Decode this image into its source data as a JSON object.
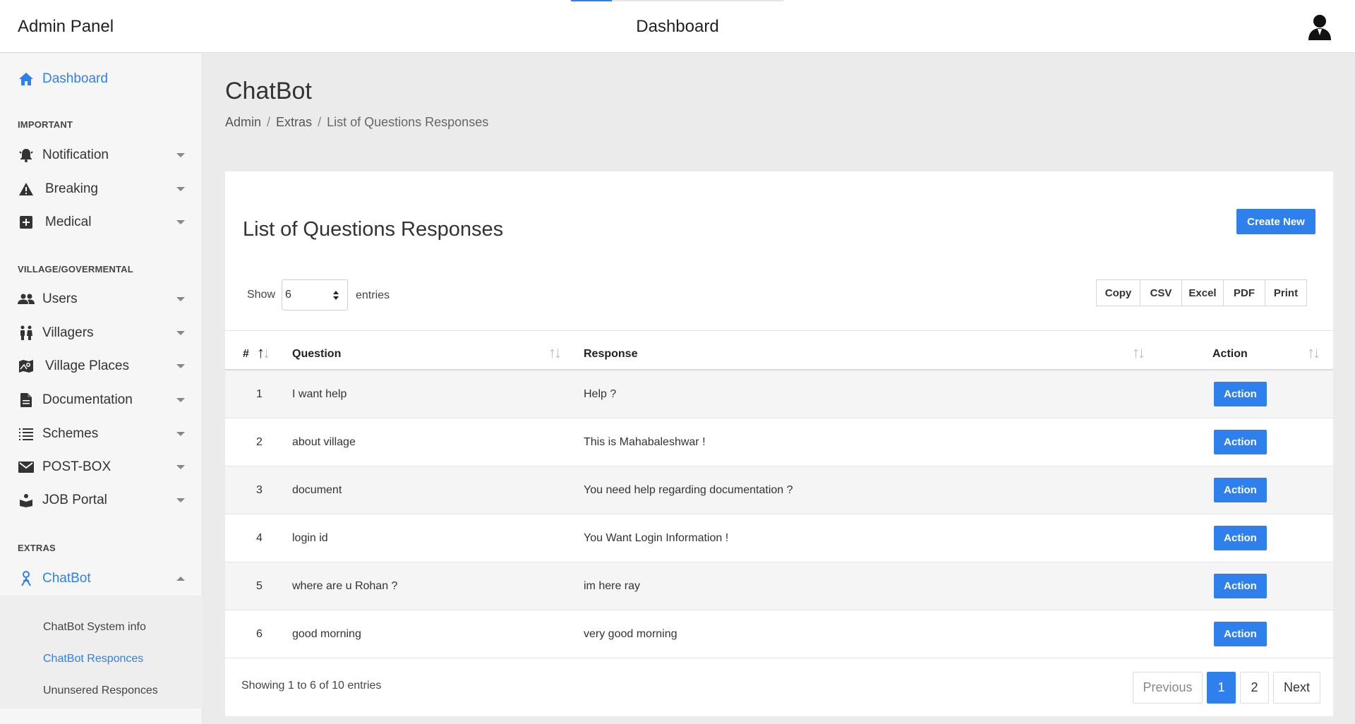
{
  "header": {
    "brand": "Admin Panel",
    "title": "Dashboard",
    "load_progress": 0.193
  },
  "sidebar": {
    "dashboard": "Dashboard",
    "sections": {
      "important": "IMPORTANT",
      "village": "VILLAGE/GOVERMENTAL",
      "extras": "EXTRAS"
    },
    "items": {
      "notification": "Notification",
      "breaking": "Breaking",
      "medical": "Medical",
      "users": "Users",
      "villagers": "Villagers",
      "village_places": "Village Places",
      "documentation": "Documentation",
      "schemes": "Schemes",
      "postbox": "POST-BOX",
      "job_portal": "JOB Portal",
      "chatbot": "ChatBot"
    },
    "chatbot_sub": {
      "system_info": "ChatBot System info",
      "responces": "ChatBot Responces",
      "unanswered": "Ununsered Responces"
    }
  },
  "page": {
    "title": "ChatBot",
    "breadcrumb": [
      "Admin",
      "Extras",
      "List of Questions Responses"
    ]
  },
  "card": {
    "title": "List of Questions Responses",
    "create_label": "Create New",
    "show_label": "Show",
    "page_size": "6",
    "entries_label": "entries",
    "exports": [
      "Copy",
      "CSV",
      "Excel",
      "PDF",
      "Print"
    ],
    "columns": [
      "#",
      "Question",
      "Response",
      "Action"
    ],
    "rows": [
      {
        "num": "1",
        "question": "I want help",
        "response": "Help ?",
        "action": "Action"
      },
      {
        "num": "2",
        "question": "about village",
        "response": "This is Mahabaleshwar !",
        "action": "Action"
      },
      {
        "num": "3",
        "question": "document",
        "response": "You need help regarding documentation ?",
        "action": "Action"
      },
      {
        "num": "4",
        "question": "login id",
        "response": "You Want Login Information !",
        "action": "Action"
      },
      {
        "num": "5",
        "question": "where are u Rohan ?",
        "response": "im here ray",
        "action": "Action"
      },
      {
        "num": "6",
        "question": "good morning",
        "response": "very good morning",
        "action": "Action"
      }
    ],
    "info": "Showing 1 to 6 of 10 entries",
    "pager": {
      "previous": "Previous",
      "page1": "1",
      "page2": "2",
      "next": "Next"
    }
  },
  "colors": {
    "accent": "#2f80ed"
  }
}
